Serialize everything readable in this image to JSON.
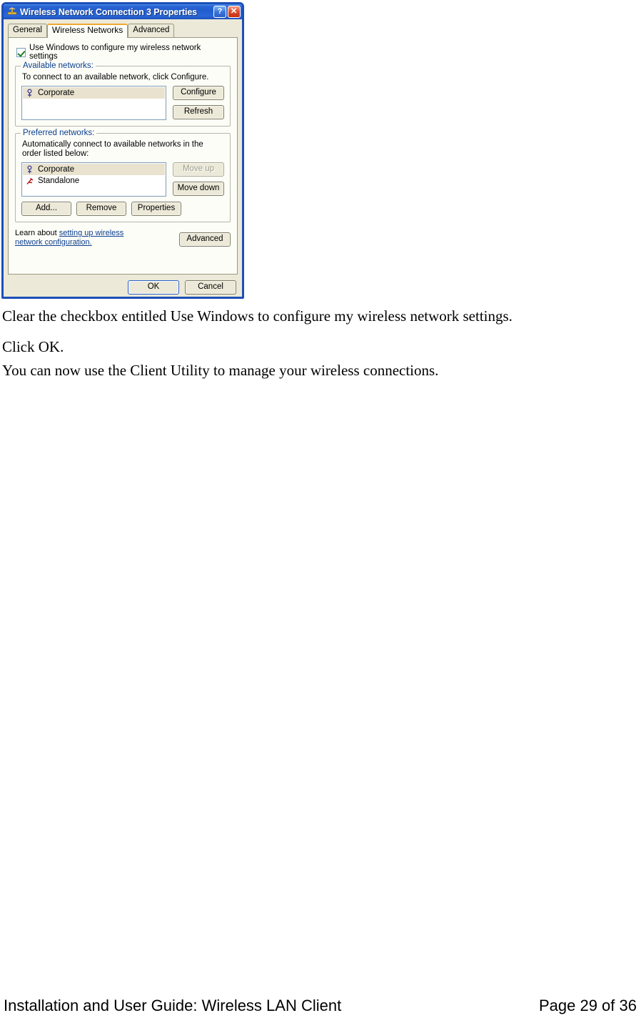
{
  "dialog": {
    "title": "Wireless Network Connection 3 Properties",
    "title_icon": "network-adapter-icon",
    "help_button": "?",
    "close_button": "✕",
    "tabs": [
      {
        "label": "General",
        "active": false
      },
      {
        "label": "Wireless Networks",
        "active": true
      },
      {
        "label": "Advanced",
        "active": false
      }
    ],
    "use_windows_checkbox": {
      "label": "Use Windows to configure my wireless network settings",
      "checked": true
    },
    "available_networks": {
      "legend": "Available networks:",
      "description": "To connect to an available network, click Configure.",
      "items": [
        {
          "name": "Corporate",
          "icon": "access-point-icon",
          "selected": true
        }
      ],
      "buttons": [
        "Configure",
        "Refresh"
      ]
    },
    "preferred_networks": {
      "legend": "Preferred networks:",
      "description": "Automatically connect to available networks in the order listed below:",
      "items": [
        {
          "name": "Corporate",
          "icon": "access-point-icon",
          "selected": true
        },
        {
          "name": "Standalone",
          "icon": "ad-hoc-network-icon",
          "selected": false
        }
      ],
      "move_up": {
        "label": "Move up",
        "enabled": false
      },
      "move_down": {
        "label": "Move down",
        "enabled": true
      },
      "buttons": [
        "Add...",
        "Remove",
        "Properties"
      ]
    },
    "learn_about": {
      "prefix": "Learn about ",
      "link": "setting up wireless network configuration.",
      "advanced_button": "Advanced"
    },
    "footer_buttons": {
      "ok": "OK",
      "cancel": "Cancel"
    },
    "colors": {
      "titlebar_blue": "#225ccd",
      "dialog_face": "#ece9d8",
      "tab_active_accent": "#f0a830",
      "link_blue": "#0b3f8f",
      "close_red": "#c22e10",
      "selection_beige": "#e8e2cf"
    }
  },
  "page": {
    "paragraphs": [
      "Clear the checkbox entitled Use Windows to configure my wireless network settings.",
      "Click OK.",
      "You can now use the Client Utility to manage your wireless connections."
    ],
    "footer": {
      "left": "Installation and User Guide: Wireless LAN Client",
      "right": "Page 29 of 36"
    }
  }
}
